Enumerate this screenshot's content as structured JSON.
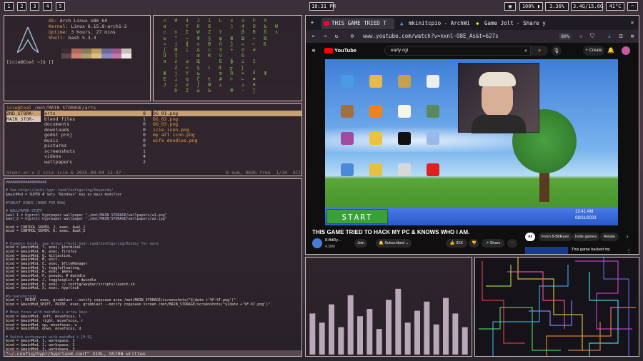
{
  "topbar": {
    "workspaces": [
      "1",
      "2",
      "3",
      "4",
      "5"
    ],
    "clock": "10:31 PM",
    "status": {
      "battery": "100%",
      "cpu": "3.36%",
      "memory": "3.4G/15.6G",
      "temp": "41°C"
    }
  },
  "neofetch": {
    "os_key": "OS:",
    "os": "Arch Linux x86_64",
    "kernel_key": "Kernel:",
    "kernel": "Linux 6.15.8-arch1-2",
    "uptime_key": "Uptime:",
    "uptime": "3 hours, 27 mins",
    "shell_key": "Shell:",
    "shell": "bash 5.3.3",
    "prompt": "[icie@Coal ~]$ []"
  },
  "filemanager": {
    "path_user": "icie@Coal",
    "path_dir": "/mnt/MAIN_STORAGE/arts",
    "sidebar": [
      "2ND_STORA-",
      "MAIN_STOR-"
    ],
    "dirs": [
      {
        "name": "arts",
        "count": "8"
      },
      {
        "name": "blend files",
        "count": "1"
      },
      {
        "name": "documents",
        "count": "0"
      },
      {
        "name": "downloads",
        "count": "0"
      },
      {
        "name": "godot proj",
        "count": "0"
      },
      {
        "name": "music",
        "count": "0"
      },
      {
        "name": "pictures",
        "count": "0"
      },
      {
        "name": "screenshots",
        "count": "1"
      },
      {
        "name": "videos",
        "count": "4"
      },
      {
        "name": "wallpapers",
        "count": "2"
      }
    ],
    "files": [
      "DG_01.png",
      "DG_02.png",
      "DG_03.png",
      "icie_icon.png",
      "my art icon.png",
      "wife doodles.png"
    ],
    "status_left": "drwxr-xr-x 2 icie icie 6 2025-08-04 12:37",
    "status_right": "0 sum, 869G free  1/10  All"
  },
  "editor": {
    "lines": [
      "###################",
      "",
      "# See https://wiki.hypr.land/Configuring/Keywords/",
      "$mainMod = SUPER # Sets \"Windows\" key as main modifier",
      "",
      "#TABLET BINDS (NONE FOR NOW)",
      "",
      "# WALLPAPER STUFF",
      "$wal_1 = hyprctl hyprpaper wallpaper \",/mnt/MAIN_STORAGE/wallpapers/w1.png\"",
      "$wal_2 = hyprctl hyprpaper wallpaper \",/mnt/MAIN_STORAGE/wallpapers/w2.jpg\"",
      "",
      "bind = CONTROL_SUPER, J, exec, $wal_1",
      "bind = CONTROL_SUPER, K, exec, $wal_2",
      "",
      "",
      "# Example binds, see https://wiki.hypr.land/Configuring/Binds/ for more",
      "bind = $mainMod, T, exec, $terminal",
      "bind = $mainMod, W, exec, firefox",
      "bind = $mainMod, Q, killactive,",
      "bind = $mainMod, M, exit,",
      "bind = $mainMod, E, exec, $fileManager",
      "bind = $mainMod, V, togglefloating,",
      "bind = $mainMod, R, exec, $menu",
      "bind = $mainMod, P, pseudo, # dwindle",
      "bind = $mainMod, J, togglesplit, # dwindle",
      "bind = $mainMod, H, exec, ~/.config/waybar/scripts/launch.sh",
      "bind = $mainMod, X, exec, hyprlock",
      "",
      "#Screenshoting",
      "bind = , PRINT, exec, grimblast --notify copysave area /mnt/MAIN_STORAGE/screenshots/\"$(date +'%F-%T.png')\"",
      "bind = $mainMod_SHIFT, PRINT, exec, grimblast --notify copysave screen /mnt/MAIN_STORAGE/screenshots/\"$(date +'%F-%T.png')\"",
      "",
      "# Move focus with mainMod + arrow keys",
      "bind = $mainMod, left, movefocus, l",
      "bind = $mainMod, right, movefocus, r",
      "bind = $mainMod, up, movefocus, u",
      "bind = $mainMod, down, movefocus, d",
      "",
      "# Switch workspaces with mainMod + [0-9]",
      "bind = $mainMod, 1, workspace, 1",
      "bind = $mainMod, 2, workspace, 2",
      "bind = $mainMod, 3, workspace, 3"
    ],
    "status": "\"~/.config/hypr/hyprland.conf\" 319L, 9570B written"
  },
  "browser": {
    "tabs": [
      {
        "label": "THIS GAME TRIED T"
      },
      {
        "label": "mkinitcpio - ArchWiki"
      },
      {
        "label": "Game Jolt - Share your"
      }
    ],
    "url": "www.youtube.com/watch?v=nxnl-O8E_As&t=627s",
    "zoom": "80%",
    "search_value": "early cgi",
    "create_label": "Create",
    "youtube_logo": "YouTube",
    "video": {
      "title": "THIS GAME TRIED TO HACK MY PC & KNOWS WHO I AM.",
      "channel": "8-BitRy...",
      "subs": "4.38M",
      "join": "Join",
      "subscribed": "Subscribed",
      "likes": "31K",
      "share": "Share",
      "start_label": "START",
      "time": "12:41 AM",
      "date": "08/11/2023"
    },
    "chips": [
      "All",
      "From 8-BitRyan",
      "Indie games",
      "Relate"
    ],
    "side_video_title": "This game hacked my"
  },
  "visualizer": {
    "bars": [
      0.45,
      0.35,
      0.55,
      0.3,
      0.65,
      0.42,
      0.5,
      0.28,
      0.6,
      0.72,
      0.35,
      0.48,
      0.58,
      0.33,
      0.62,
      0.45,
      0.3
    ]
  }
}
